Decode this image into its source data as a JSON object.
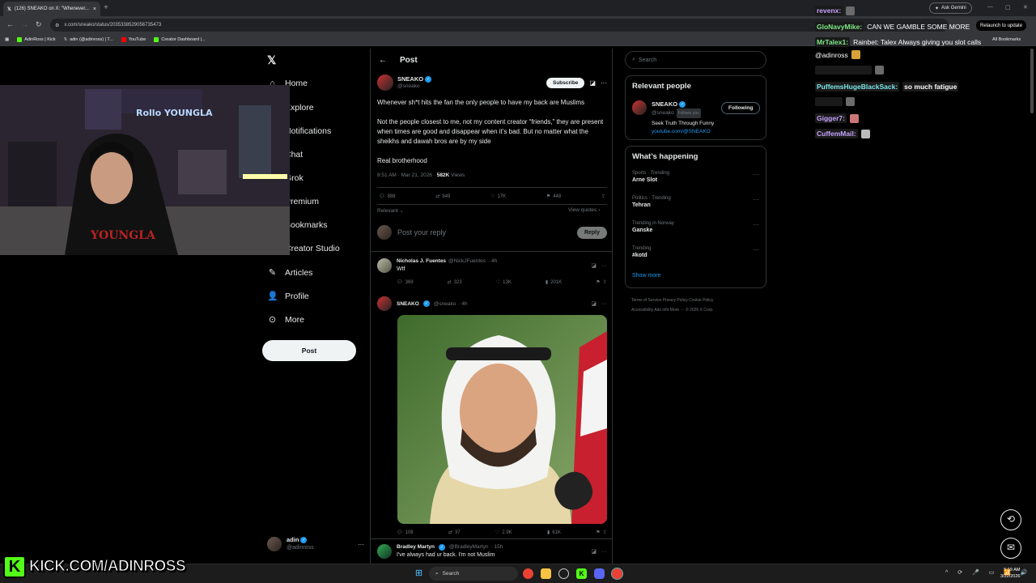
{
  "browser": {
    "tab_title": "(126) SNEAKO on X: \"Whenever...",
    "new_tab": "+",
    "ask_gemini": "Ask Gemini",
    "url": "x.com/sneako/status/2035338529056735473",
    "relaunch": "Relaunch to update",
    "bookmarks": [
      "AdinRoss | Kick",
      "adin (@adinross) | T...",
      "YouTube",
      "Creator Dashboard |..."
    ],
    "all_bookmarks": "All Bookmarks"
  },
  "nav": {
    "items": [
      "Home",
      "Explore",
      "Notifications",
      "Chat",
      "Grok",
      "Premium",
      "Bookmarks",
      "Creator Studio",
      "Articles",
      "Profile",
      "More"
    ],
    "post_button": "Post",
    "account_name": "adin",
    "account_handle": "@adinross",
    "account_more": "···"
  },
  "main": {
    "header": "Post",
    "post": {
      "author": "SNEAKO",
      "handle": "@sneako",
      "subscribe": "Subscribe",
      "text1": "Whenever sh*t hits the fan the only people to have my back are Muslims",
      "text2": "Not the people closest to me, not my content creator “friends,” they are present when times are good and disappear when it’s bad. But no matter what the sheikhs and dawah bros are by my side",
      "text3": "Real brotherhood",
      "time": "8:51 AM · Mar 21, 2026 · ",
      "views_count": "582K",
      "views_label": " Views",
      "replies": "888",
      "reposts": "849",
      "likes": "17K",
      "bookmarks": "448",
      "sort": "Relevant",
      "view_quotes": "View quotes"
    },
    "reply_box": {
      "placeholder": "Post your reply",
      "button": "Reply"
    },
    "reply1": {
      "author": "Nicholas J. Fuentes",
      "handle": "@NickJFuentes",
      "time": "· 4h",
      "text": "Wtf",
      "replies": "369",
      "reposts": "323",
      "likes": "13K",
      "views": "201K"
    },
    "reply2": {
      "author": "SNEAKO",
      "handle": "@sneako",
      "time": "· 4h",
      "replies": "108",
      "reposts": "37",
      "likes": "2.9K",
      "views": "61K"
    },
    "reply3": {
      "author": "Bradley Martyn",
      "handle": "@BradleyMartyn",
      "time": "· 15h",
      "text": "I've always had ur back. I'm not Muslim"
    }
  },
  "right": {
    "search_placeholder": "Search",
    "relevant_title": "Relevant people",
    "rel_name": "SNEAKO",
    "rel_handle": "@sneako",
    "follows_you": "Follows you",
    "following": "Following",
    "rel_bio": "Seek Truth Through Funny",
    "rel_link": "youtube.com/@SNEAKO",
    "happening_title": "What’s happening",
    "trends": [
      {
        "ctx": "Sports · Trending",
        "topic": "Arne Slot"
      },
      {
        "ctx": "Politics · Trending",
        "topic": "Tehran"
      },
      {
        "ctx": "Trending in Norway",
        "topic": "Ganske"
      },
      {
        "ctx": "Trending",
        "topic": "#kotd"
      }
    ],
    "show_more": "Show more",
    "footer1": "Terms of Service   Privacy Policy   Cookie Policy",
    "footer2": "Accessibility   Ads info   More ···   © 2026 X Corp."
  },
  "chat": [
    {
      "name": "revenx:",
      "msg": "",
      "color": "#c8a2ff"
    },
    {
      "name": "GloNavyMike:",
      "msg": "CAN WE GAMBLE SOME MORE",
      "color": "#7ee787"
    },
    {
      "name": "MrTalex1:",
      "msg": "Rainbet: Talex   Always giving you slot calls",
      "color": "#7ee787"
    },
    {
      "name": "",
      "msg": "@adinross",
      "color": "#ffffff"
    },
    {
      "name": "",
      "msg": "",
      "color": "#ff4d4d"
    },
    {
      "name": "PuffemsHugeBlackSack:",
      "msg": "so much fatigue",
      "color": "#7ee7e7"
    },
    {
      "name": "",
      "msg": "",
      "color": "#ff4d4d"
    },
    {
      "name": "Gigger7:",
      "msg": "",
      "color": "#c8a2ff"
    },
    {
      "name": "CuffemMail:",
      "msg": "",
      "color": "#c8a2ff"
    }
  ],
  "kick_overlay": "KICK.COM/ADINROSS",
  "taskbar": {
    "search": "Search",
    "time": "5:19 AM",
    "date": "3/22/2026"
  },
  "colors": {
    "accent": "#1d9bf0",
    "kick_green": "#53fc18"
  }
}
